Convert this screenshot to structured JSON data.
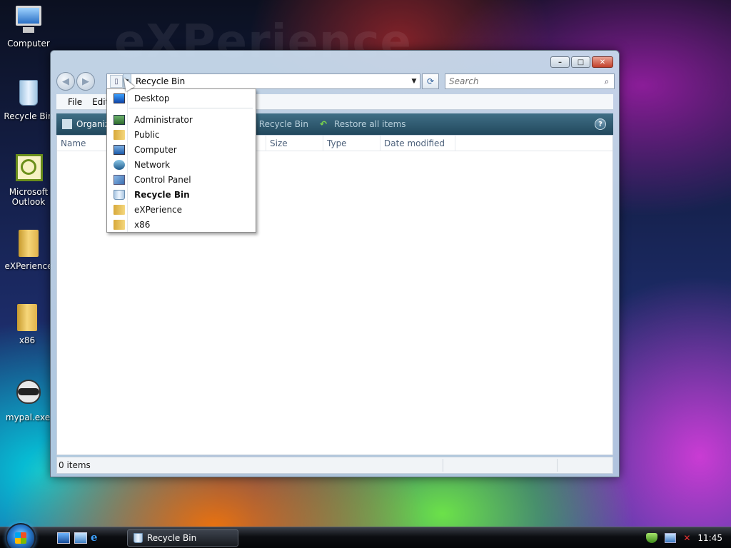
{
  "wallpaper": {
    "text": "eXPerience"
  },
  "desktop_icons": [
    {
      "label": "Computer",
      "icon": "computer-icon"
    },
    {
      "label": "Recycle Bin",
      "icon": "recycle-bin-icon"
    },
    {
      "label": "Microsoft Outlook",
      "icon": "outlook-icon"
    },
    {
      "label": "eXPerience",
      "icon": "folder-icon"
    },
    {
      "label": "x86",
      "icon": "folder-icon"
    },
    {
      "label": "mypal.exe",
      "icon": "raccoon-icon"
    }
  ],
  "window": {
    "caption_buttons": {
      "minimize": "–",
      "maximize": "□",
      "close": "✕"
    },
    "address": {
      "value": "Recycle Bin"
    },
    "search": {
      "placeholder": "Search"
    },
    "menu": {
      "file": "File",
      "edit": "Edit"
    },
    "command_bar": {
      "organize": "Organize",
      "empty_bin": "Empty the Recycle Bin",
      "restore_all": "Restore all items"
    },
    "columns": [
      "Name",
      "Size",
      "Type",
      "Date modified"
    ],
    "status": "0 items"
  },
  "breadcrumb_dropdown": {
    "items": [
      {
        "label": "Desktop",
        "icon": "desktop-icon"
      },
      {
        "label": "Administrator",
        "icon": "user-folder-icon"
      },
      {
        "label": "Public",
        "icon": "folder-icon"
      },
      {
        "label": "Computer",
        "icon": "computer-icon"
      },
      {
        "label": "Network",
        "icon": "network-icon"
      },
      {
        "label": "Control Panel",
        "icon": "control-panel-icon"
      },
      {
        "label": "Recycle Bin",
        "icon": "recycle-bin-icon",
        "selected": true
      },
      {
        "label": "eXPerience",
        "icon": "folder-icon"
      },
      {
        "label": "x86",
        "icon": "folder-icon"
      }
    ]
  },
  "taskbar": {
    "active_window": "Recycle Bin",
    "clock": "11:45"
  }
}
